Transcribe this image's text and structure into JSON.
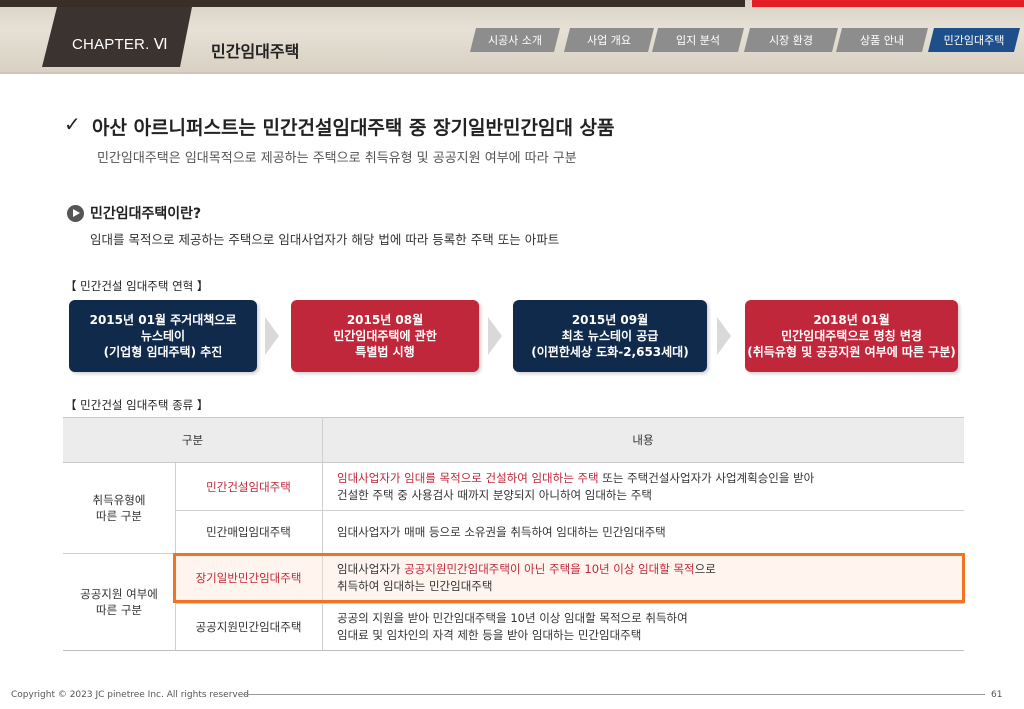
{
  "header": {
    "chapter": "CHAPTER. Ⅵ",
    "title": "민간임대주택",
    "nav_tabs": [
      {
        "label": "시공사 소개",
        "active": false
      },
      {
        "label": "사업 개요",
        "active": false
      },
      {
        "label": "입지 분석",
        "active": false
      },
      {
        "label": "시장 환경",
        "active": false
      },
      {
        "label": "상품 안내",
        "active": false
      },
      {
        "label": "민간임대주택",
        "active": true
      }
    ]
  },
  "headline": {
    "check": "✓",
    "title": "아산 아르니퍼스트는 민간건설임대주택 중 장기일반민간임대 상품",
    "subtitle": "민간임대주택은 임대목적으로 제공하는 주택으로 취득유형 및 공공지원 여부에 따라 구분"
  },
  "definition": {
    "title": "민간임대주택이란?",
    "text": "임대를 목적으로 제공하는 주택으로 임대사업자가 해당 법에 따라 등록한 주택 또는 아파트"
  },
  "history": {
    "label": "【 민간건설 임대주택 연혁 】",
    "steps": [
      {
        "lines": [
          "2015년 01월 주거대책으로",
          "뉴스테이",
          "(기업형 임대주택) 추진"
        ],
        "color": "navy"
      },
      {
        "lines": [
          "2015년 08월",
          "민간임대주택에 관한",
          "특별법 시행"
        ],
        "color": "red"
      },
      {
        "lines": [
          "2015년 09월",
          "최초 뉴스테이 공급",
          "(이편한세상 도화-2,653세대)"
        ],
        "color": "navy"
      },
      {
        "lines": [
          "2018년 01월",
          "민간임대주택으로 명칭 변경",
          "(취득유형 및 공공지원 여부에 따른 구분)"
        ],
        "color": "red"
      }
    ]
  },
  "types": {
    "label": "【 민간건설 임대주택 종류 】",
    "header": {
      "category": "구분",
      "content": "내용"
    },
    "groups": [
      {
        "name_lines": [
          "취득유형에",
          "따른 구분"
        ]
      },
      {
        "name_lines": [
          "공공지원 여부에",
          "따른 구분"
        ]
      }
    ],
    "rows": [
      {
        "type": "민간건설임대주택",
        "type_red": true,
        "line1_red": "임대사업자가 임대를 목적으로 건설하여 임대하는 주택",
        "line1_rest": " 또는 주택건설사업자가 사업계획승인을 받아",
        "line2": "건설한 주택 중 사용검사 때까지 분양되지 아니하여 임대하는 주택"
      },
      {
        "type": "민간매입임대주택",
        "type_red": false,
        "line1": "임대사업자가 매매 등으로 소유권을 취득하여 임대하는 민간임대주택"
      },
      {
        "type": "장기일반민간임대주택",
        "type_red": true,
        "line1_pre": "임대사업자가 ",
        "line1_red": "공공지원민간임대주택이 아닌 주택을 10년 이상 임대할 목적",
        "line1_post": "으로",
        "line2": "취득하여 임대하는 민간임대주택"
      },
      {
        "type": "공공지원민간임대주택",
        "type_red": false,
        "line1": "공공의 지원을 받아 민간임대주택을 10년 이상 임대할 목적으로 취득하여",
        "line2": "임대료 및 임차인의 자격 제한 등을 받아 임대하는 민간임대주택"
      }
    ]
  },
  "footer": {
    "copyright": "Copyright © 2023 JC pinetree Inc. All rights reserved",
    "page": "61"
  },
  "colors": {
    "navy": "#102a4c",
    "red": "#c1273a",
    "highlight": "#f07423",
    "nav_active": "#1f4f8a",
    "nav_inactive": "#8d8d8d"
  }
}
